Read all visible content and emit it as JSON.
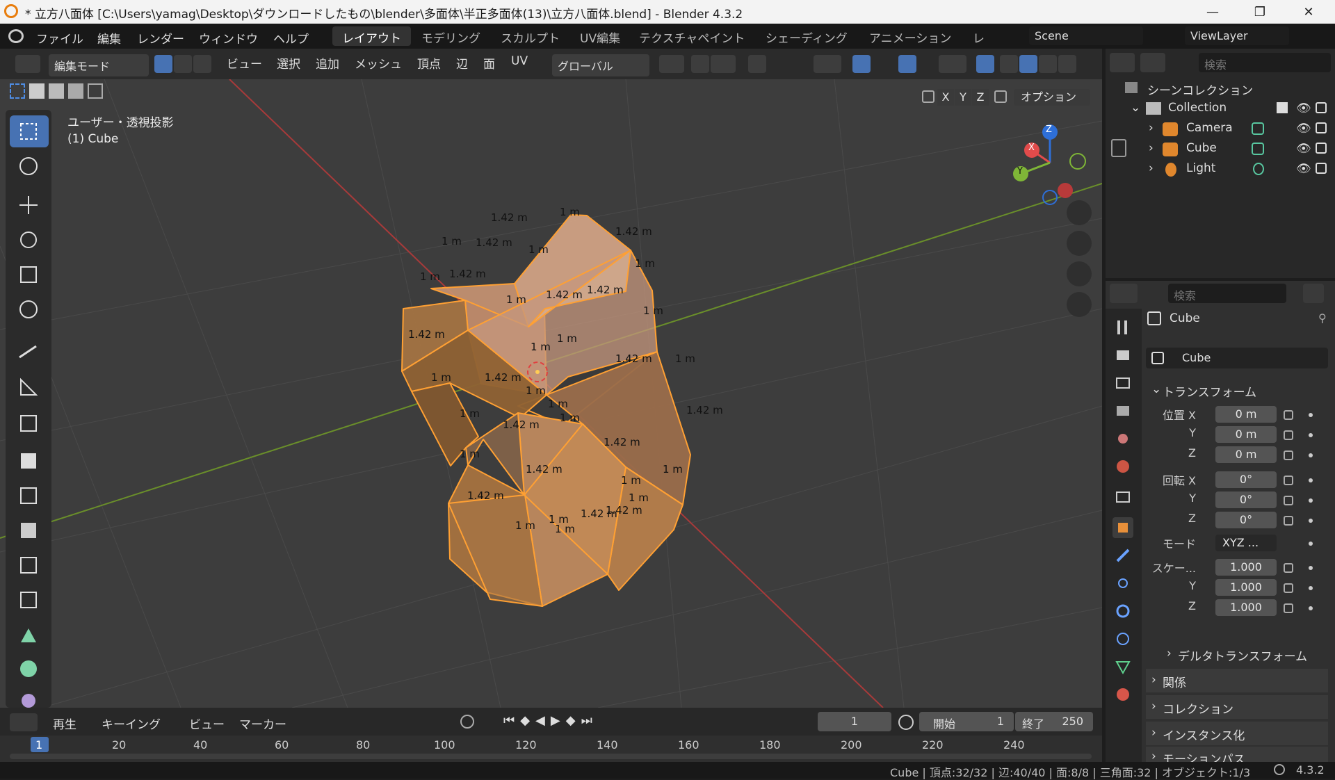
{
  "window": {
    "title": "* 立方八面体 [C:\\Users\\yamag\\Desktop\\ダウンロードしたもの\\blender\\多面体\\半正多面体(13)\\立方八面体.blend] - Blender 4.3.2",
    "min": "—",
    "max": "❐",
    "close": "✕"
  },
  "menu": [
    "ファイル",
    "編集",
    "レンダー",
    "ウィンドウ",
    "ヘルプ"
  ],
  "workspaces": [
    "レイアウト",
    "モデリング",
    "スカルプト",
    "UV編集",
    "テクスチャペイント",
    "シェーディング",
    "アニメーション",
    "レ"
  ],
  "scene": "Scene",
  "viewlayer": "ViewLayer",
  "header3d": {
    "mode": "編集モード",
    "items": [
      "ビュー",
      "選択",
      "追加",
      "メッシュ",
      "頂点",
      "辺",
      "面",
      "UV"
    ],
    "orientation": "グローバル",
    "options": "オプション",
    "x": "X",
    "y": "Y",
    "z": "Z"
  },
  "viewport": {
    "projection": "ユーザー・透視投影",
    "object": "(1) Cube",
    "gizmo": {
      "x": "X",
      "y": "Y",
      "z": "Z"
    },
    "measure_long": "1.42 m",
    "measure_short": "1 m"
  },
  "outliner": {
    "search": "検索",
    "scene_collection": "シーンコレクション",
    "collection": "Collection",
    "items": [
      "Camera",
      "Cube",
      "Light"
    ]
  },
  "props": {
    "search": "検索",
    "object_name": "Cube",
    "datablock": "Cube",
    "transform": "トランスフォーム",
    "location_label": "位置 X",
    "rotation_label": "回転 X",
    "scale_label": "スケー...",
    "y": "Y",
    "z": "Z",
    "loc": [
      "0 m",
      "0 m",
      "0 m"
    ],
    "rot": [
      "0°",
      "0°",
      "0°"
    ],
    "mode_label": "モード",
    "mode": "XYZ ...",
    "scale": [
      "1.000",
      "1.000",
      "1.000"
    ],
    "sections": [
      "デルタトランスフォーム",
      "関係",
      "コレクション",
      "インスタンス化",
      "モーションパス"
    ]
  },
  "timeline": {
    "menus": [
      "再生",
      "キーイング",
      "ビュー",
      "マーカー"
    ],
    "frame": "1",
    "start_label": "開始",
    "start": "1",
    "end_label": "終了",
    "end": "250",
    "ticks": [
      "1",
      "20",
      "40",
      "60",
      "80",
      "100",
      "120",
      "140",
      "160",
      "180",
      "200",
      "220",
      "240"
    ]
  },
  "status": {
    "text": "Cube | 頂点:32/32 | 辺:40/40 | 面:8/8 | 三角面:32 | オブジェクト:1/3",
    "version": "4.3.2"
  },
  "colors": {
    "accent": "#4772b3",
    "face": "#e59b4b",
    "edge": "#ffa033"
  }
}
